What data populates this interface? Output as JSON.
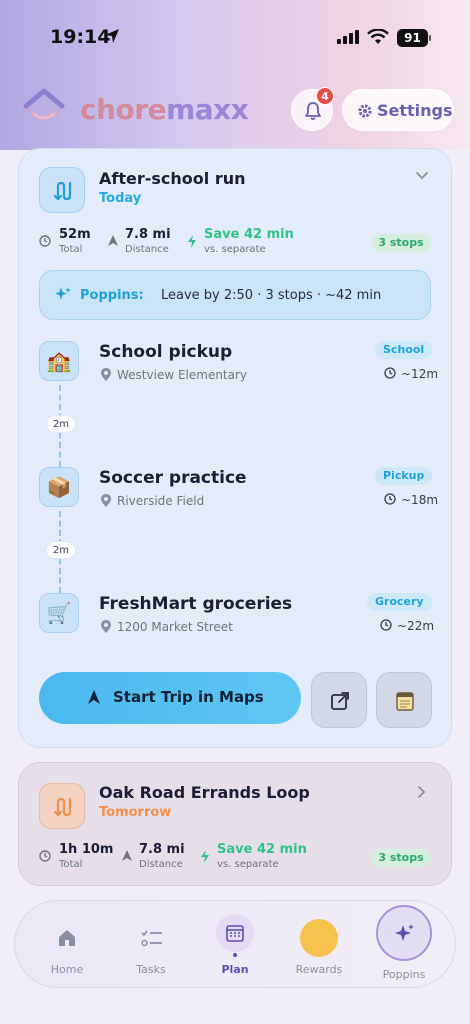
{
  "status_bar": {
    "time": "19:14",
    "battery": "91"
  },
  "app": {
    "brand_part1": "chore",
    "brand_part2": "maxx",
    "notifications_count": "4",
    "settings_label": "Settings"
  },
  "colors": {
    "accent": "#4ab8ef",
    "brand_pink": "#d38a9a",
    "brand_purple": "#9a86d6",
    "success": "#2fc38a",
    "orange": "#f0904c"
  },
  "trip1": {
    "title": "After-school run",
    "when": "Today",
    "total_val": "52m",
    "total_lbl": "Total",
    "distance_val": "7.8 mi",
    "distance_lbl": "Distance",
    "save_val": "Save 42 min",
    "save_lbl": "vs. separate",
    "stops_badge": "3 stops",
    "poppins_label": "Poppins:",
    "poppins_text": "Leave by 2:50 · 3 stops · ~42 min",
    "stops": [
      {
        "name": "School pickup",
        "address": "Westview Elementary",
        "type": "School",
        "duration": "~12m",
        "emoji": "🏫"
      },
      {
        "name": "Soccer practice",
        "address": "Riverside Field",
        "type": "Pickup",
        "duration": "~18m",
        "emoji": "📦"
      },
      {
        "name": "FreshMart groceries",
        "address": "1200 Market Street",
        "type": "Grocery",
        "duration": "~22m",
        "emoji": "🛒"
      }
    ],
    "gaps": [
      "2m",
      "2m"
    ],
    "start_label": "Start Trip in Maps"
  },
  "trip2": {
    "title": "Oak Road Errands Loop",
    "when": "Tomorrow",
    "total_val": "1h 10m",
    "total_lbl": "Total",
    "distance_val": "7.8 mi",
    "distance_lbl": "Distance",
    "save_val": "Save 42 min",
    "save_lbl": "vs. separate",
    "stops_badge": "3 stops"
  },
  "tabs": [
    {
      "label": "Home",
      "icon": "house-icon"
    },
    {
      "label": "Tasks",
      "icon": "checklist-icon"
    },
    {
      "label": "Plan",
      "icon": "calendar-icon",
      "active": true
    },
    {
      "label": "Rewards",
      "icon": "coin-icon"
    },
    {
      "label": "Poppins",
      "icon": "sparkle-icon"
    }
  ]
}
